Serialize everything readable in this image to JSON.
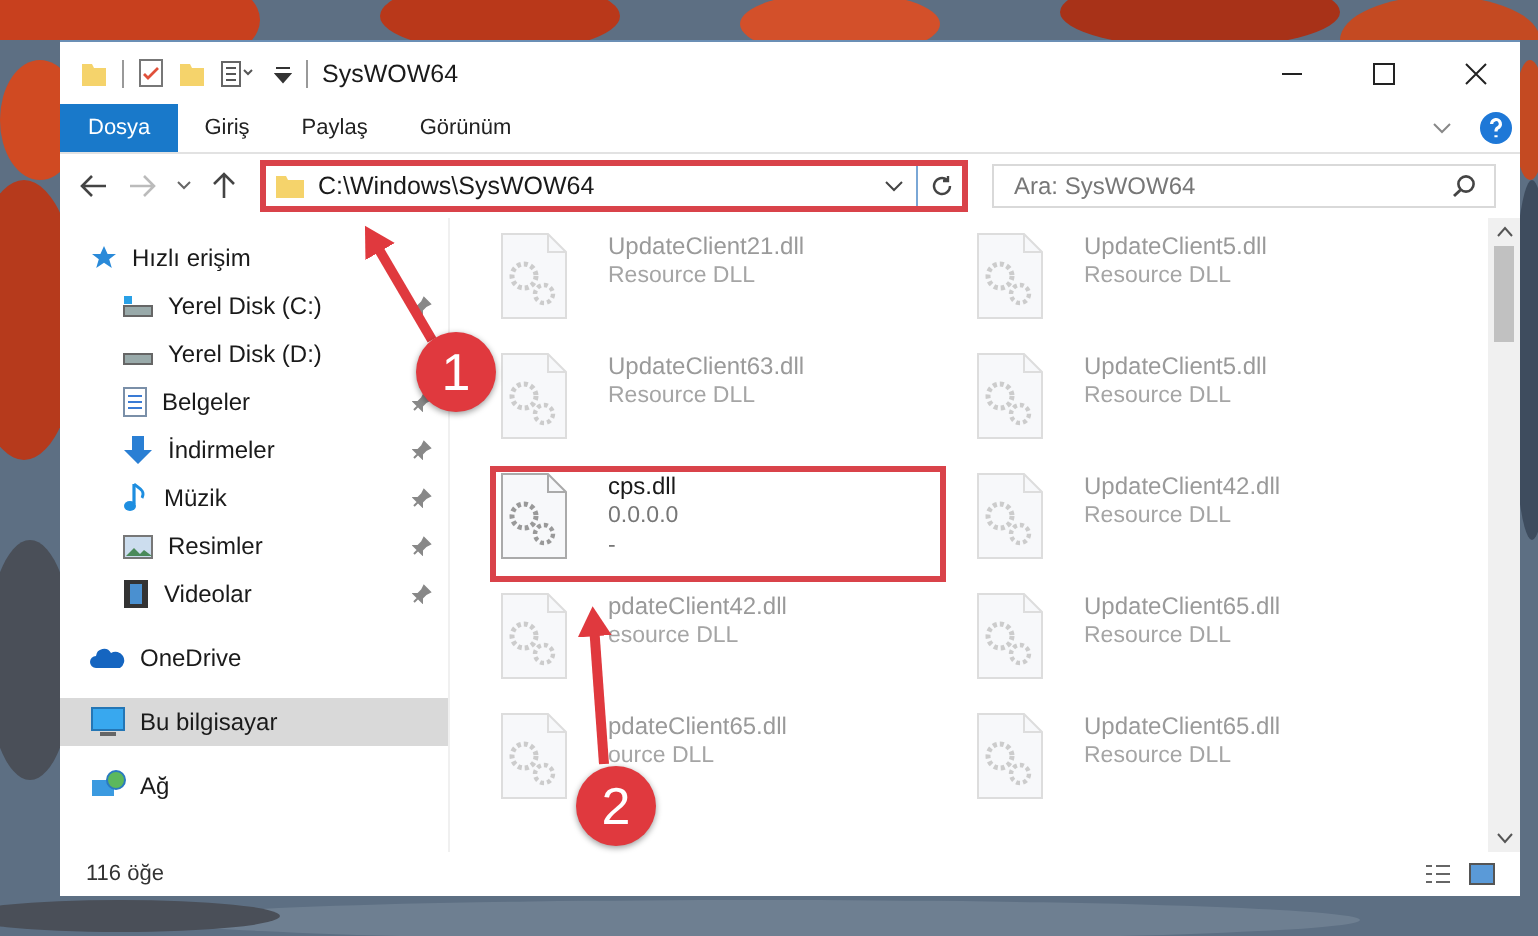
{
  "window": {
    "title": "SysWOW64"
  },
  "ribbon_tabs": [
    {
      "label": "Dosya",
      "kind": "file",
      "selected": false
    },
    {
      "label": "Giriş",
      "kind": "tab",
      "selected": false
    },
    {
      "label": "Paylaş",
      "kind": "tab",
      "selected": false
    },
    {
      "label": "Görünüm",
      "kind": "tab",
      "selected": false
    }
  ],
  "address_bar": {
    "path": "C:\\Windows\\SysWOW64",
    "highlighted": true
  },
  "search": {
    "placeholder": "Ara: SysWOW64"
  },
  "sidebar": {
    "items": [
      {
        "label": "Hızlı erişim",
        "selected": false,
        "children": [
          {
            "label": "Yerel Disk (C:)",
            "pinned": true,
            "selected": false
          },
          {
            "label": "Yerel Disk (D:)",
            "pinned": false,
            "selected": false
          },
          {
            "label": "Belgeler",
            "pinned": true,
            "selected": false
          },
          {
            "label": "İndirmeler",
            "pinned": true,
            "selected": false
          },
          {
            "label": "Müzik",
            "pinned": true,
            "selected": false
          },
          {
            "label": "Resimler",
            "pinned": true,
            "selected": false
          },
          {
            "label": "Videolar",
            "pinned": true,
            "selected": false
          }
        ]
      },
      {
        "label": "OneDrive",
        "selected": false
      },
      {
        "label": "Bu bilgisayar",
        "selected": true
      },
      {
        "label": "Ağ",
        "selected": false
      }
    ]
  },
  "files": [
    {
      "name": "UpdateClient21.dll",
      "lines": [
        "Resource DLL"
      ],
      "faded": true,
      "highlighted": false
    },
    {
      "name": "UpdateClient5.dll",
      "lines": [
        "Resource DLL"
      ],
      "faded": true,
      "highlighted": false
    },
    {
      "name": "UpdateClient63.dll",
      "lines": [
        "Resource DLL"
      ],
      "faded": true,
      "highlighted": false
    },
    {
      "name": "UpdateClient5.dll",
      "lines": [
        "Resource DLL"
      ],
      "faded": true,
      "highlighted": false
    },
    {
      "name": "cps.dll",
      "lines": [
        "0.0.0.0",
        "-"
      ],
      "faded": false,
      "highlighted": true
    },
    {
      "name": "UpdateClient42.dll",
      "lines": [
        "Resource DLL"
      ],
      "faded": true,
      "highlighted": false
    },
    {
      "name": "pdateClient42.dll",
      "lines": [
        "esource DLL"
      ],
      "faded": true,
      "highlighted": false
    },
    {
      "name": "UpdateClient65.dll",
      "lines": [
        "Resource DLL"
      ],
      "faded": true,
      "highlighted": false
    },
    {
      "name": "pdateClient65.dll",
      "lines": [
        "ource DLL"
      ],
      "faded": true,
      "highlighted": false
    },
    {
      "name": "UpdateClient65.dll",
      "lines": [
        "Resource DLL"
      ],
      "faded": true,
      "highlighted": false
    }
  ],
  "status_bar": {
    "count": "116 öğe"
  },
  "annotations": [
    {
      "number": "1"
    },
    {
      "number": "2"
    }
  ]
}
